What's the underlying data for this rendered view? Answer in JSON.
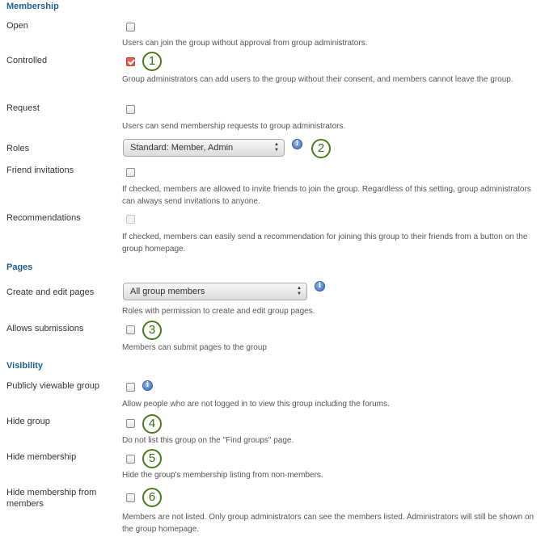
{
  "membership": {
    "heading": "Membership",
    "open": {
      "label": "Open",
      "desc": "Users can join the group without approval from group administrators."
    },
    "controlled": {
      "label": "Controlled",
      "desc": "Group administrators can add users to the group without their consent, and members cannot leave the group."
    },
    "request": {
      "label": "Request",
      "desc": "Users can send membership requests to group administrators."
    },
    "roles": {
      "label": "Roles",
      "value": "Standard: Member, Admin"
    },
    "friend_invitations": {
      "label": "Friend invitations",
      "desc": "If checked, members are allowed to invite friends to join the group. Regardless of this setting, group administrators can always send invitations to anyone."
    },
    "recommendations": {
      "label": "Recommendations",
      "desc": "If checked, members can easily send a recommendation for joining this group to their friends from a button on the group homepage."
    }
  },
  "pages": {
    "heading": "Pages",
    "create_edit": {
      "label": "Create and edit pages",
      "value": "All group members",
      "desc": "Roles with permission to create and edit group pages."
    },
    "submissions": {
      "label": "Allows submissions",
      "desc": "Members can submit pages to the group"
    }
  },
  "visibility": {
    "heading": "Visibility",
    "public": {
      "label": "Publicly viewable group",
      "desc": "Allow people who are not logged in to view this group including the forums."
    },
    "hide_group": {
      "label": "Hide group",
      "desc": "Do not list this group on the \"Find groups\" page."
    },
    "hide_membership": {
      "label": "Hide membership",
      "desc": "Hide the group's membership listing from non-members."
    },
    "hide_members": {
      "label_line1": "Hide membership from",
      "label_line2": "members",
      "desc": "Members are not listed. Only group administrators can see the members listed. Administrators will still be shown on the group homepage."
    }
  },
  "callouts": [
    "1",
    "2",
    "3",
    "4",
    "5",
    "6"
  ],
  "icons": {
    "info": "info-icon",
    "info_glyph": "i"
  },
  "colors": {
    "section": "#1f5f8f",
    "callout": "#4a7a1a",
    "checked": "#e8624f"
  }
}
